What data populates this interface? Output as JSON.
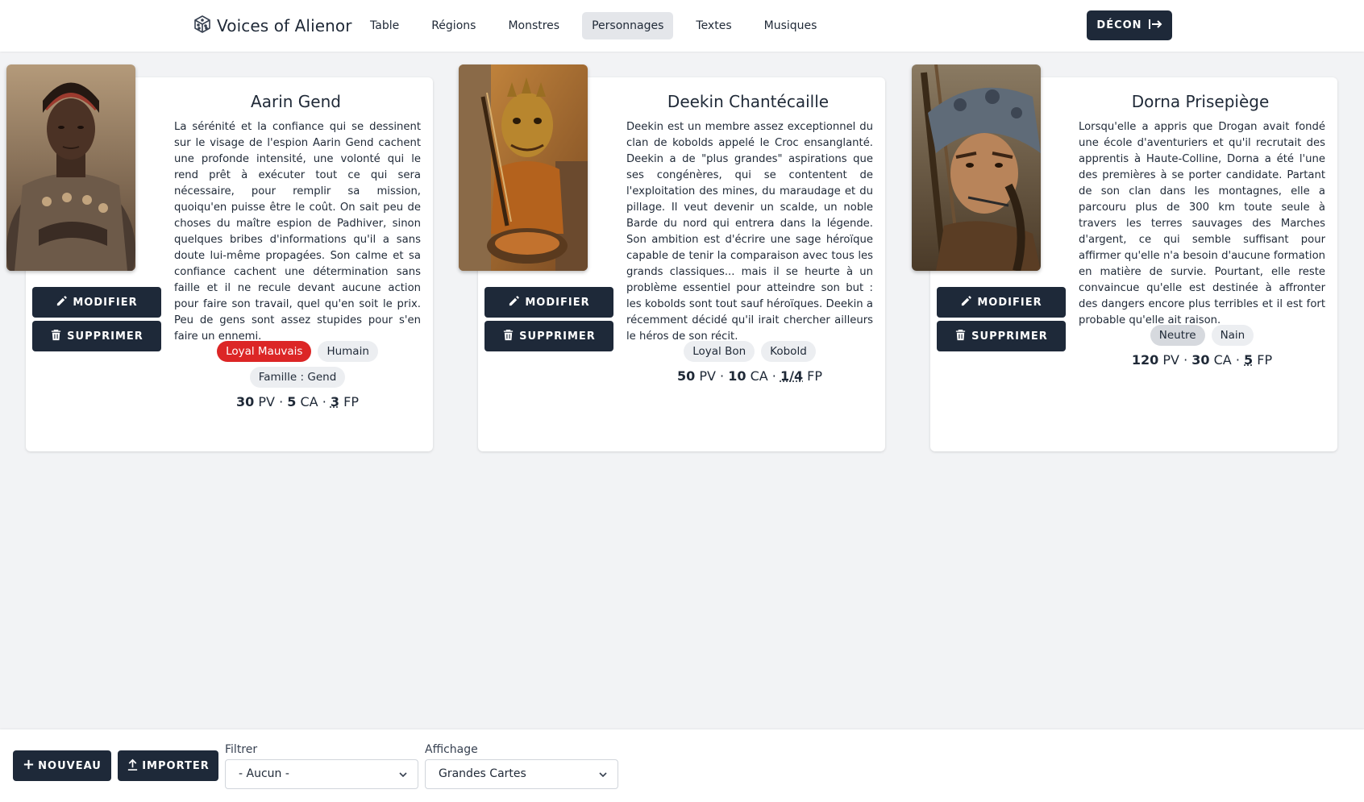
{
  "app": {
    "title": "Voices of Alienor"
  },
  "nav": {
    "items": [
      "Table",
      "Régions",
      "Monstres",
      "Personnages",
      "Textes",
      "Musiques"
    ],
    "active": "Personnages",
    "logout_label": "DÉCON"
  },
  "cards": [
    {
      "name": "Aarin Gend",
      "description": "La sérénité et la confiance qui se dessinent sur le visage de l'espion Aarin Gend cachent une profonde intensité, une volonté qui le rend prêt à exécuter tout ce qui sera nécessaire, pour remplir sa mission, quoiqu'en puisse être le coût. On sait peu de choses du maître espion de Padhiver, sinon quelques bribes d'informations qu'il a sans doute lui-même propagées. Son calme et sa confiance cachent une détermination sans faille et il ne recule devant aucune action pour faire son travail, quel qu'en soit le prix. Peu de gens sont assez stupides pour s'en faire un ennemi.",
      "tags": [
        "Loyal Mauvais",
        "Humain",
        "Famille : Gend"
      ],
      "alignment_color": "#dc2626",
      "pv": "30",
      "ca": "5",
      "fp": "3",
      "edit_label": "MODIFIER",
      "delete_label": "SUPPRIMER"
    },
    {
      "name": "Deekin Chantécaille",
      "description": "Deekin est un membre assez exceptionnel du clan de kobolds appelé le Croc ensanglanté. Deekin a de \"plus grandes\" aspirations que ses congénères, qui se contentent de l'exploitation des mines, du maraudage et du pillage. Il veut devenir un scalde, un noble Barde du nord qui entrera dans la légende. Son ambition est d'écrire une sage héroïque capable de tenir la comparaison avec tous les grands classiques... mais il se heurte à un problème essentiel pour atteindre son but : les kobolds sont tout sauf héroïques. Deekin a récemment décidé qu'il irait chercher ailleurs le héros de son récit.",
      "tags": [
        "Loyal Bon",
        "Kobold"
      ],
      "pv": "50",
      "ca": "10",
      "fp": "1/4",
      "edit_label": "MODIFIER",
      "delete_label": "SUPPRIMER"
    },
    {
      "name": "Dorna Prisepiège",
      "description": "Lorsqu'elle a appris que Drogan avait fondé une école d'aventuriers et qu'il recrutait des apprentis à Haute-Colline, Dorna a été l'une des premières à se porter candidate. Partant de son clan dans les montagnes, elle a parcouru plus de 300 km toute seule à travers les terres sauvages des Marches d'argent, ce qui semble suffisant pour affirmer qu'elle n'a besoin d'aucune formation en matière de survie. Pourtant, elle reste convaincue qu'elle est destinée à affronter des dangers encore plus terribles et il est fort probable qu'elle ait raison.",
      "tags": [
        "Neutre",
        "Nain"
      ],
      "pv": "120",
      "ca": "30",
      "fp": "5",
      "edit_label": "MODIFIER",
      "delete_label": "SUPPRIMER"
    }
  ],
  "stat_units": {
    "pv": "PV",
    "ca": "CA",
    "fp": "FP",
    "sep": "·"
  },
  "bottom": {
    "new_label": "NOUVEAU",
    "import_label": "IMPORTER",
    "filter_label": "Filtrer",
    "filter_value": "- Aucun -",
    "display_label": "Affichage",
    "display_value": "Grandes Cartes"
  },
  "colors": {
    "dark": "#1e2939",
    "alignment_evil": "#dc2626",
    "background": "#f2f3f5"
  }
}
